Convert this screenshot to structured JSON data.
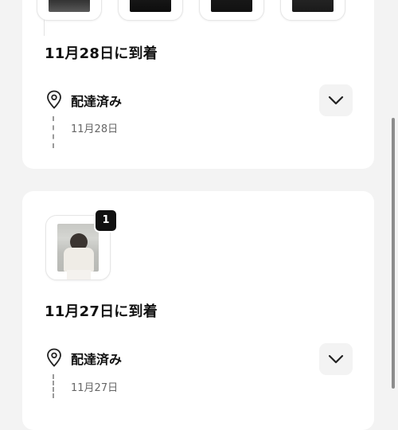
{
  "orders": [
    {
      "arrival_title": "11月28日に到着",
      "item_thumbnails": [
        "item-photo-1",
        "item-photo-2",
        "item-photo-3",
        "item-photo-4"
      ],
      "status": "配達済み",
      "status_date": "11月28日"
    },
    {
      "arrival_title": "11月27日に到着",
      "item_count_badge": "1",
      "status": "配達済み",
      "status_date": "11月27日"
    }
  ],
  "icons": {
    "location": "location-pin-icon",
    "expand": "chevron-down-icon"
  },
  "colors": {
    "background": "#f3f3f3",
    "card": "#ffffff",
    "text": "#111111",
    "muted": "#666666"
  }
}
